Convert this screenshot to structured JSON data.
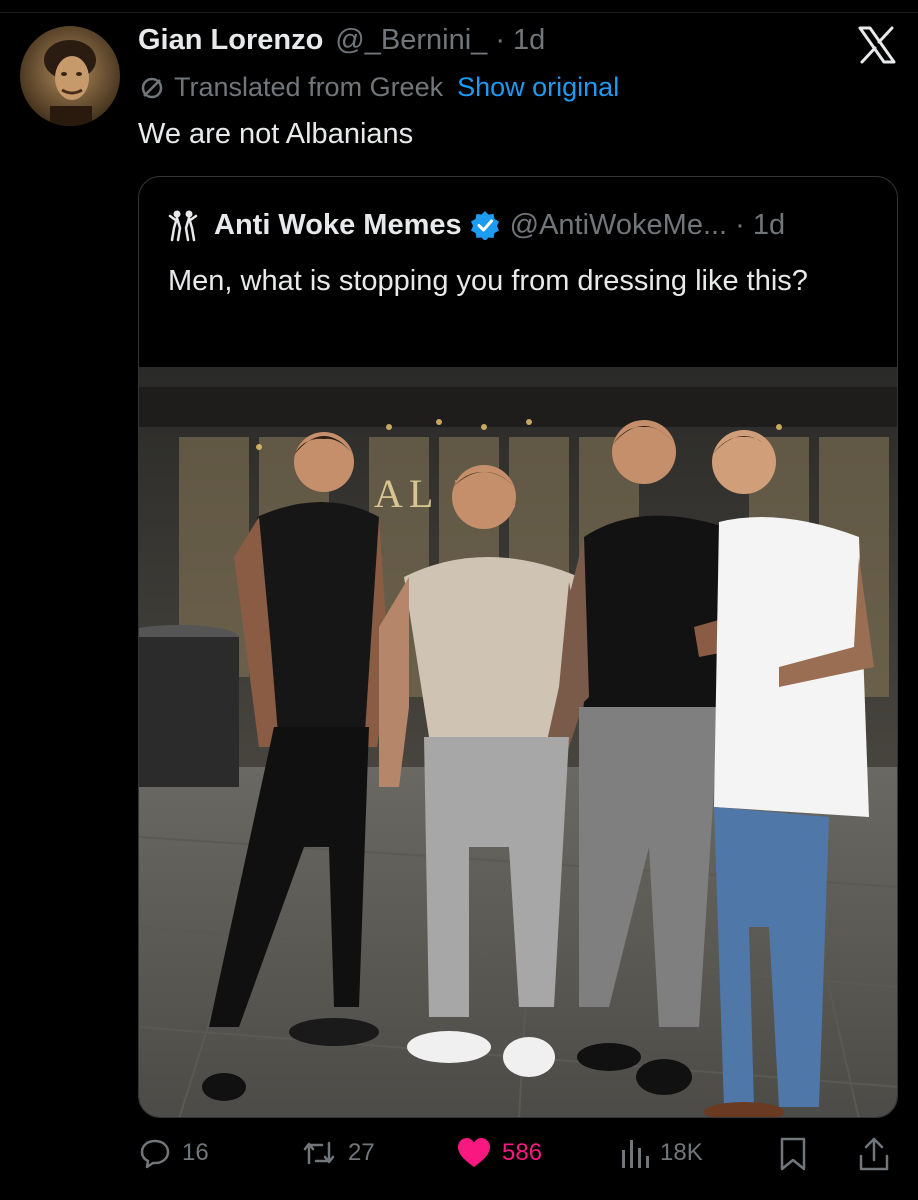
{
  "tweet": {
    "author_name": "Gian Lorenzo",
    "author_handle": "@_Bernini_ · 1d",
    "translated_label": "Translated from Greek",
    "show_original_label": "Show original",
    "text": "We are not Albanians"
  },
  "quote": {
    "author_name": "Anti Woke Memes",
    "author_handle": "@AntiWokeMe... · 1d",
    "text": "Men, what is stopping you from dressing like this?",
    "photo_sign_text": "AL    BA"
  },
  "actions": {
    "replies": "16",
    "retweets": "27",
    "likes": "586",
    "views": "18K"
  },
  "colors": {
    "background": "#000000",
    "primary_text": "#e7e9ea",
    "secondary_text": "#71767b",
    "link": "#1d9bf0",
    "like": "#f91880",
    "verified": "#1d9bf0"
  }
}
